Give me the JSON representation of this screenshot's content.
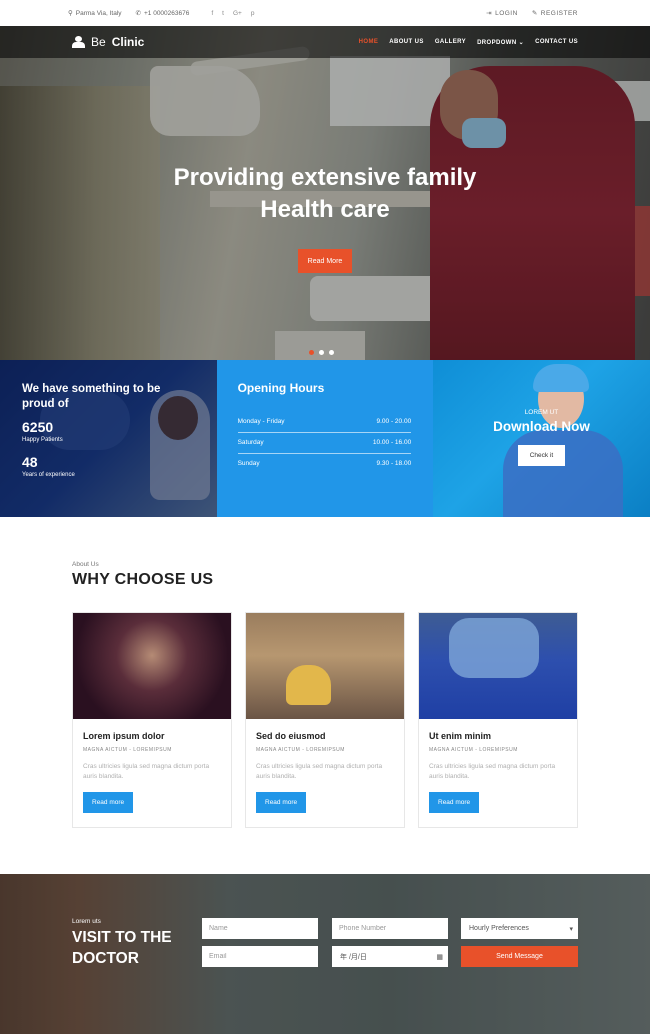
{
  "topbar": {
    "location": "Parma Via, Italy",
    "phone": "+1 0000263676",
    "social": [
      "f",
      "t",
      "G+",
      "p"
    ],
    "login": "LOGIN",
    "register": "REGISTER"
  },
  "brand": {
    "be": "Be",
    "clinic": "Clinic"
  },
  "menu": [
    "HOME",
    "ABOUT US",
    "GALLERY",
    "DROPDOWN",
    "CONTACT US"
  ],
  "hero": {
    "line1": "Providing extensive family",
    "line2": "Health care",
    "button": "Read More"
  },
  "stats": {
    "title": "We have something to be proud of",
    "patients_count": "6250",
    "patients_label": "Happy Patients",
    "years_count": "48",
    "years_label": "Years of experience"
  },
  "hours": {
    "title": "Opening Hours",
    "rows": [
      {
        "day": "Monday - Friday",
        "time": "9.00 - 20.00"
      },
      {
        "day": "Saturday",
        "time": "10.00 - 16.00"
      },
      {
        "day": "Sunday",
        "time": "9.30 - 18.00"
      }
    ]
  },
  "download": {
    "eyebrow": "LOREM UT",
    "title": "Download Now",
    "button": "Check it"
  },
  "why": {
    "eyebrow": "About Us",
    "title": "WHY CHOOSE US",
    "cards": [
      {
        "title": "Lorem ipsum dolor",
        "meta": "MAGNA AICTUM - LOREMIPSUM",
        "desc": "Cras ultricies ligula sed magna dictum porta auris blandita.",
        "button": "Read more"
      },
      {
        "title": "Sed do eiusmod",
        "meta": "MAGNA AICTUM - LOREMIPSUM",
        "desc": "Cras ultricies ligula sed magna dictum porta auris blandita.",
        "button": "Read more"
      },
      {
        "title": "Ut enim minim",
        "meta": "MAGNA AICTUM - LOREMIPSUM",
        "desc": "Cras ultricies ligula sed magna dictum porta auris blandita.",
        "button": "Read more"
      }
    ]
  },
  "visit": {
    "eyebrow": "Lorem uts",
    "title_line1": "VISIT TO THE",
    "title_line2": "DOCTOR",
    "name_placeholder": "Name",
    "phone_placeholder": "Phone Number",
    "select_value": "Hourly Preferences",
    "email_placeholder": "Email",
    "date_value": "年 /月/日",
    "send": "Send Message"
  },
  "colors": {
    "accent": "#e8512a",
    "blue": "#2196e8"
  }
}
